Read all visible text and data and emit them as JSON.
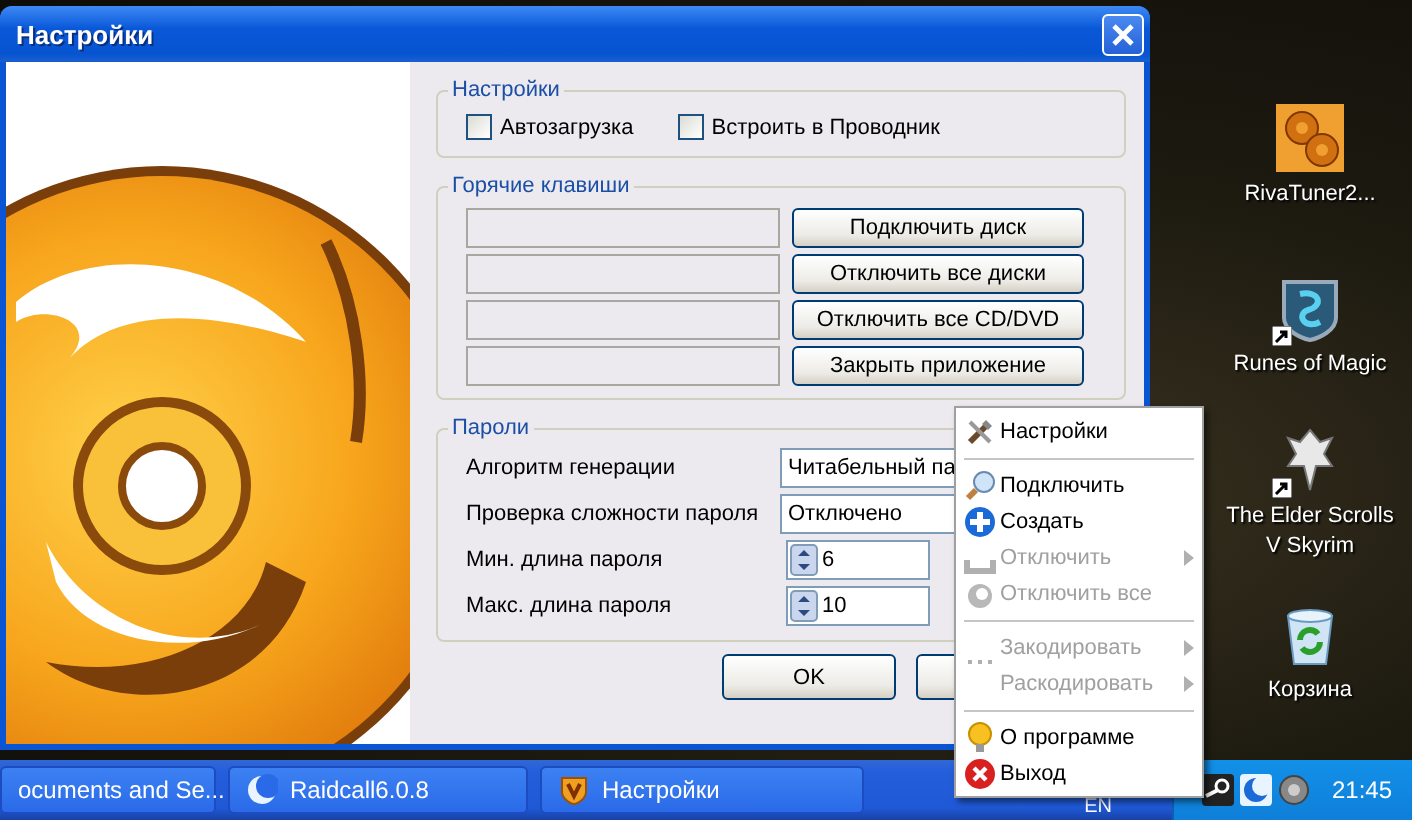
{
  "dialog": {
    "title": "Настройки",
    "settings_group": {
      "title": "Настройки",
      "checkboxes": [
        {
          "label": "Автозагрузка",
          "checked": false
        },
        {
          "label": "Встроить в Проводник",
          "checked": false
        }
      ]
    },
    "hotkeys_group": {
      "title": "Горячие клавиши",
      "rows": [
        {
          "button": "Подключить диск"
        },
        {
          "button": "Отключить все диски"
        },
        {
          "button": "Отключить все CD/DVD"
        },
        {
          "button": "Закрыть приложение"
        }
      ]
    },
    "passwords_group": {
      "title": "Пароли",
      "fields": [
        {
          "kind": "combo",
          "label": "Алгоритм генерации",
          "value": "Читабельный па"
        },
        {
          "kind": "combo",
          "label": "Проверка сложности пароля",
          "value": "Отключено"
        },
        {
          "kind": "spin",
          "label": "Мин. длина пароля",
          "value": "6"
        },
        {
          "kind": "spin",
          "label": "Макс. длина пароля",
          "value": "10"
        }
      ]
    },
    "buttons": [
      "OK"
    ]
  },
  "desktop_icons": [
    {
      "label": "RivaTuner2...",
      "kind": "gears",
      "shortcut": false
    },
    {
      "label": "Runes of Magic",
      "kind": "shield",
      "shortcut": true
    },
    {
      "label": "The Elder Scrolls V Skyrim",
      "kind": "dragon",
      "shortcut": true
    },
    {
      "label": "Корзина",
      "kind": "bin",
      "shortcut": false
    }
  ],
  "context_menu": {
    "items": [
      {
        "kind": "item",
        "label": "Настройки",
        "disabled": false,
        "submenu": false
      },
      {
        "kind": "separator"
      },
      {
        "kind": "item",
        "label": "Подключить",
        "disabled": false,
        "submenu": false
      },
      {
        "kind": "item",
        "label": "Создать",
        "disabled": false,
        "submenu": false
      },
      {
        "kind": "item",
        "label": "Отключить",
        "disabled": true,
        "submenu": true
      },
      {
        "kind": "item",
        "label": "Отключить все",
        "disabled": true,
        "submenu": false
      },
      {
        "kind": "separator"
      },
      {
        "kind": "item",
        "label": "Закодировать",
        "disabled": true,
        "submenu": true
      },
      {
        "kind": "item",
        "label": "Раскодировать",
        "disabled": true,
        "submenu": true
      },
      {
        "kind": "separator"
      },
      {
        "kind": "item",
        "label": "О программе",
        "disabled": false,
        "submenu": false
      },
      {
        "kind": "item",
        "label": "Выход",
        "disabled": false,
        "submenu": false
      }
    ]
  },
  "taskbar": {
    "buttons": [
      {
        "label": "ocuments and Se..."
      },
      {
        "label": "Raidcall6.0.8"
      },
      {
        "label": "Настройки"
      }
    ],
    "language": "EN",
    "clock": "21:45"
  }
}
